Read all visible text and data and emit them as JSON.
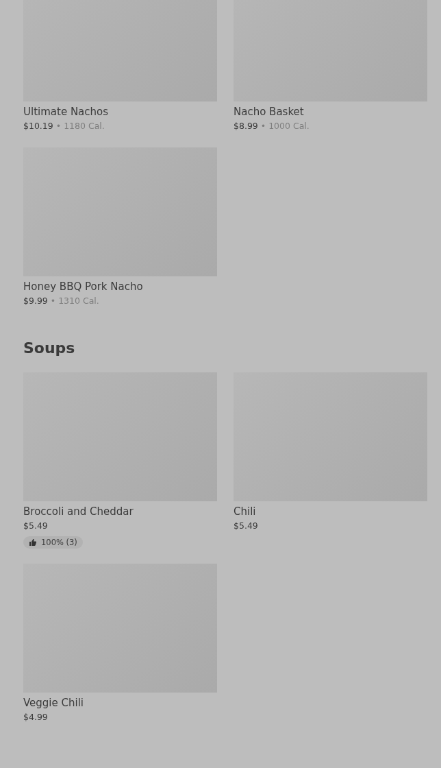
{
  "sections": [
    {
      "items": [
        {
          "name": "Ultimate Nachos",
          "price": "$10.19",
          "separator": "•",
          "calories": "1180 Cal."
        },
        {
          "name": "Nacho Basket",
          "price": "$8.99",
          "separator": "•",
          "calories": "1000 Cal."
        },
        {
          "name": "Honey BBQ Pork Nacho",
          "price": "$9.99",
          "separator": "•",
          "calories": "1310 Cal."
        }
      ]
    },
    {
      "title": "Soups",
      "items": [
        {
          "name": "Broccoli and Cheddar",
          "price": "$5.49",
          "rating": "100% (3)"
        },
        {
          "name": "Chili",
          "price": "$5.49"
        },
        {
          "name": "Veggie Chili",
          "price": "$4.99"
        }
      ]
    }
  ]
}
